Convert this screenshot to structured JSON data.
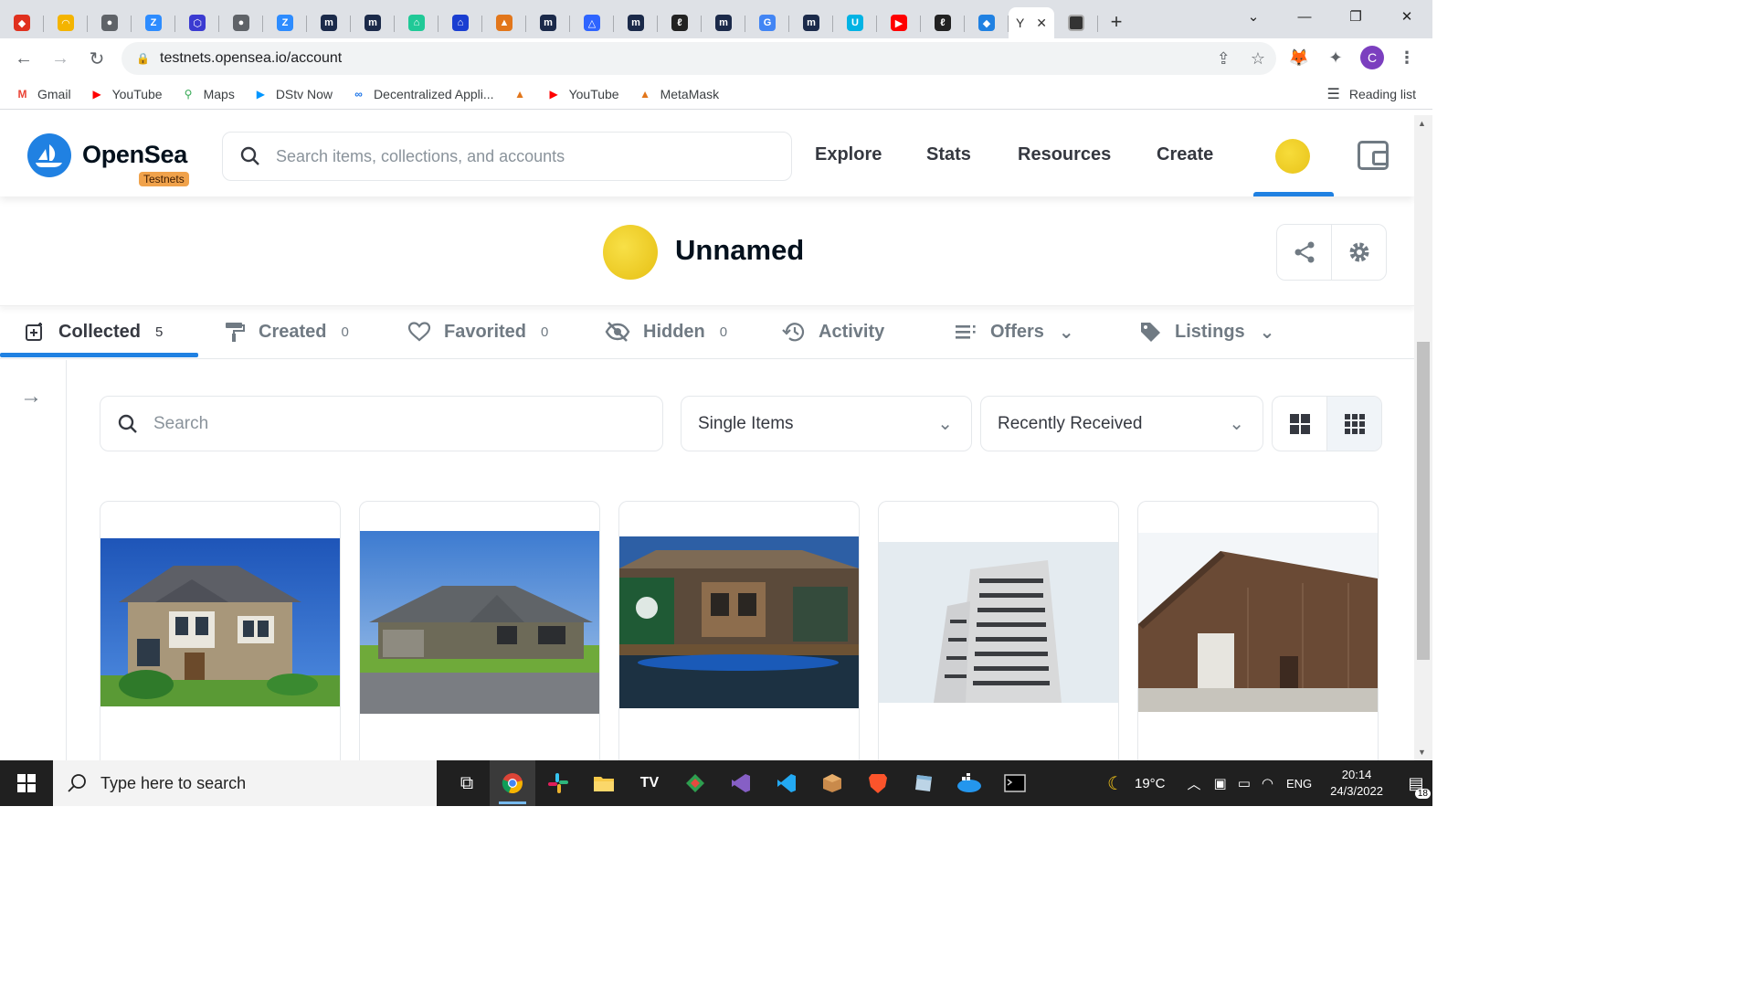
{
  "browser": {
    "tabs": [
      {
        "icon": "opensea-icon",
        "color": "#e0301e"
      },
      {
        "icon": "rainbow-icon",
        "color": "#f4b400"
      },
      {
        "icon": "globe-icon",
        "color": "#5f6368"
      },
      {
        "icon": "zoom-icon",
        "color": "#2d8cff"
      },
      {
        "icon": "hexagon-icon",
        "color": "#3b3bd1"
      },
      {
        "icon": "globe-icon",
        "color": "#5f6368"
      },
      {
        "icon": "zoom-icon",
        "color": "#2d8cff"
      },
      {
        "icon": "moralis-icon",
        "color": "#1b2a4a"
      },
      {
        "icon": "moralis-icon",
        "color": "#1b2a4a"
      },
      {
        "icon": "home-icon",
        "color": "#20c997"
      },
      {
        "icon": "building-icon",
        "color": "#1a3ed1"
      },
      {
        "icon": "metamask-icon",
        "color": "#e2761b"
      },
      {
        "icon": "moralis-icon",
        "color": "#1b2a4a"
      },
      {
        "icon": "alchemy-icon",
        "color": "#2e64ff"
      },
      {
        "icon": "moralis-icon",
        "color": "#1b2a4a"
      },
      {
        "icon": "script-icon",
        "color": "#222222"
      },
      {
        "icon": "moralis-icon",
        "color": "#1b2a4a"
      },
      {
        "icon": "google-icon",
        "color": "#4285f4"
      },
      {
        "icon": "moralis-icon",
        "color": "#1b2a4a"
      },
      {
        "icon": "udacity-icon",
        "color": "#02b3e4"
      },
      {
        "icon": "youtube-icon",
        "color": "#ff0000"
      },
      {
        "icon": "script-icon",
        "color": "#222222"
      },
      {
        "icon": "opensea-icon",
        "color": "#2081e2"
      }
    ],
    "active_tab_letter": "Y",
    "url": "testnets.opensea.io/account",
    "bookmarks": [
      {
        "label": "Gmail",
        "icon": "gmail-icon",
        "color": "#ea4335"
      },
      {
        "label": "YouTube",
        "icon": "youtube-icon",
        "color": "#ff0000"
      },
      {
        "label": "Maps",
        "icon": "maps-icon",
        "color": "#34a853"
      },
      {
        "label": "DStv Now",
        "icon": "dstv-icon",
        "color": "#0096ff"
      },
      {
        "label": "Decentralized Appli...",
        "icon": "dapp-icon",
        "color": "#1a73e8"
      },
      {
        "label": "",
        "icon": "metamask-icon",
        "color": "#e2761b"
      },
      {
        "label": "YouTube",
        "icon": "youtube-icon",
        "color": "#ff0000"
      },
      {
        "label": "MetaMask",
        "icon": "metamask-icon",
        "color": "#e2761b"
      }
    ],
    "reading_list": "Reading list",
    "profile_initial": "C"
  },
  "opensea": {
    "brand": "OpenSea",
    "badge": "Testnets",
    "search_placeholder": "Search items, collections, and accounts",
    "nav": [
      "Explore",
      "Stats",
      "Resources",
      "Create"
    ],
    "brand_color": "#2081e2"
  },
  "profile": {
    "name": "Unnamed"
  },
  "tabs": [
    {
      "label": "Collected",
      "count": "5"
    },
    {
      "label": "Created",
      "count": "0"
    },
    {
      "label": "Favorited",
      "count": "0"
    },
    {
      "label": "Hidden",
      "count": "0"
    },
    {
      "label": "Activity",
      "count": ""
    },
    {
      "label": "Offers",
      "count": ""
    },
    {
      "label": "Listings",
      "count": ""
    }
  ],
  "filters": {
    "search_placeholder": "Search",
    "item_type": "Single Items",
    "sort": "Recently Received"
  },
  "taskbar": {
    "search_placeholder": "Type here to search",
    "weather": "19°C",
    "language": "ENG",
    "time": "20:14",
    "date": "24/3/2022",
    "notifications": "18"
  }
}
